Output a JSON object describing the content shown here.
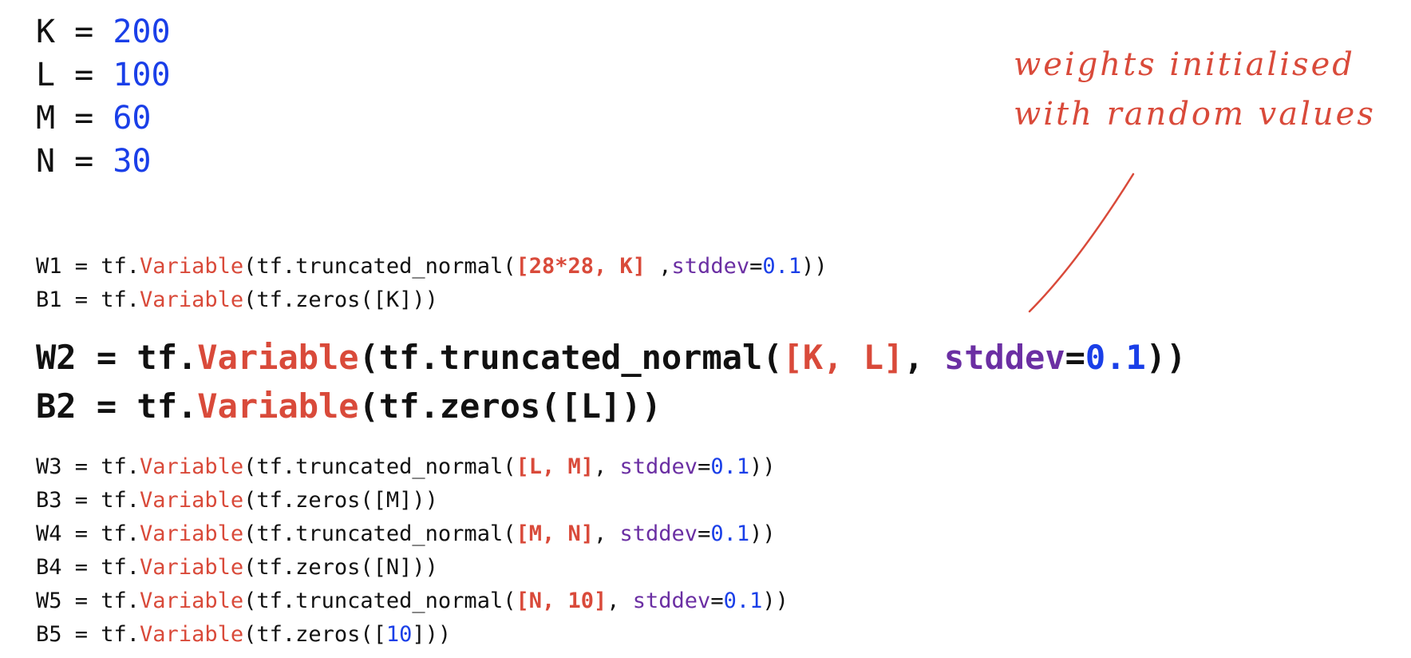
{
  "constants": [
    {
      "name": "K",
      "value": "200"
    },
    {
      "name": "L",
      "value": "100"
    },
    {
      "name": "M",
      "value": "60"
    },
    {
      "name": "N",
      "value": "30"
    }
  ],
  "annotation": {
    "line1": "weights initialised",
    "line2": "with random values"
  },
  "code_lines": [
    {
      "id": "w1",
      "size": "small",
      "tokens": [
        {
          "t": "W1 = tf.",
          "c": "plain"
        },
        {
          "t": "Variable",
          "c": "red"
        },
        {
          "t": "(tf.truncated_normal(",
          "c": "plain"
        },
        {
          "t": "[28*28, K]",
          "c": "redb"
        },
        {
          "t": " ,",
          "c": "plain"
        },
        {
          "t": "stddev",
          "c": "purple"
        },
        {
          "t": "=",
          "c": "plain"
        },
        {
          "t": "0.1",
          "c": "blue"
        },
        {
          "t": "))",
          "c": "plain"
        }
      ]
    },
    {
      "id": "b1",
      "size": "small",
      "tokens": [
        {
          "t": "B1 = tf.",
          "c": "plain"
        },
        {
          "t": "Variable",
          "c": "red"
        },
        {
          "t": "(tf.zeros([K]))",
          "c": "plain"
        }
      ]
    },
    {
      "id": "w2",
      "size": "mid",
      "tokens": [
        {
          "t": "W2 = tf.",
          "c": "plain"
        },
        {
          "t": "Variable",
          "c": "red"
        },
        {
          "t": "(tf.truncated_normal(",
          "c": "plain"
        },
        {
          "t": "[K, L]",
          "c": "redb"
        },
        {
          "t": ", ",
          "c": "plain"
        },
        {
          "t": "stddev",
          "c": "purple"
        },
        {
          "t": "=",
          "c": "plain"
        },
        {
          "t": "0.1",
          "c": "blue"
        },
        {
          "t": "))",
          "c": "plain"
        }
      ]
    },
    {
      "id": "b2",
      "size": "mid",
      "tokens": [
        {
          "t": "B2 = tf.",
          "c": "plain"
        },
        {
          "t": "Variable",
          "c": "red"
        },
        {
          "t": "(tf.zeros([L]))",
          "c": "plain"
        }
      ]
    },
    {
      "id": "w3",
      "size": "small",
      "tokens": [
        {
          "t": "W3 = tf.",
          "c": "plain"
        },
        {
          "t": "Variable",
          "c": "red"
        },
        {
          "t": "(tf.truncated_normal(",
          "c": "plain"
        },
        {
          "t": "[L, M]",
          "c": "redb"
        },
        {
          "t": ", ",
          "c": "plain"
        },
        {
          "t": "stddev",
          "c": "purple"
        },
        {
          "t": "=",
          "c": "plain"
        },
        {
          "t": "0.1",
          "c": "blue"
        },
        {
          "t": "))",
          "c": "plain"
        }
      ]
    },
    {
      "id": "b3",
      "size": "small",
      "tokens": [
        {
          "t": "B3 = tf.",
          "c": "plain"
        },
        {
          "t": "Variable",
          "c": "red"
        },
        {
          "t": "(tf.zeros([M]))",
          "c": "plain"
        }
      ]
    },
    {
      "id": "w4",
      "size": "small",
      "tokens": [
        {
          "t": "W4 = tf.",
          "c": "plain"
        },
        {
          "t": "Variable",
          "c": "red"
        },
        {
          "t": "(tf.truncated_normal(",
          "c": "plain"
        },
        {
          "t": "[M, N]",
          "c": "redb"
        },
        {
          "t": ", ",
          "c": "plain"
        },
        {
          "t": "stddev",
          "c": "purple"
        },
        {
          "t": "=",
          "c": "plain"
        },
        {
          "t": "0.1",
          "c": "blue"
        },
        {
          "t": "))",
          "c": "plain"
        }
      ]
    },
    {
      "id": "b4",
      "size": "small",
      "tokens": [
        {
          "t": "B4 = tf.",
          "c": "plain"
        },
        {
          "t": "Variable",
          "c": "red"
        },
        {
          "t": "(tf.zeros([N]))",
          "c": "plain"
        }
      ]
    },
    {
      "id": "w5",
      "size": "small",
      "tokens": [
        {
          "t": "W5 = tf.",
          "c": "plain"
        },
        {
          "t": "Variable",
          "c": "red"
        },
        {
          "t": "(tf.truncated_normal(",
          "c": "plain"
        },
        {
          "t": "[N, 10]",
          "c": "redb"
        },
        {
          "t": ", ",
          "c": "plain"
        },
        {
          "t": "stddev",
          "c": "purple"
        },
        {
          "t": "=",
          "c": "plain"
        },
        {
          "t": "0.1",
          "c": "blue"
        },
        {
          "t": "))",
          "c": "plain"
        }
      ]
    },
    {
      "id": "b5",
      "size": "small",
      "tokens": [
        {
          "t": "B5 = tf.",
          "c": "plain"
        },
        {
          "t": "Variable",
          "c": "red"
        },
        {
          "t": "(tf.zeros([",
          "c": "plain"
        },
        {
          "t": "10",
          "c": "blue"
        },
        {
          "t": "]))",
          "c": "plain"
        }
      ]
    }
  ],
  "colors": {
    "keyword_red": "#d94a3a",
    "param_purple": "#6b2fa3",
    "number_blue": "#1a3fe8",
    "text": "#111111"
  }
}
